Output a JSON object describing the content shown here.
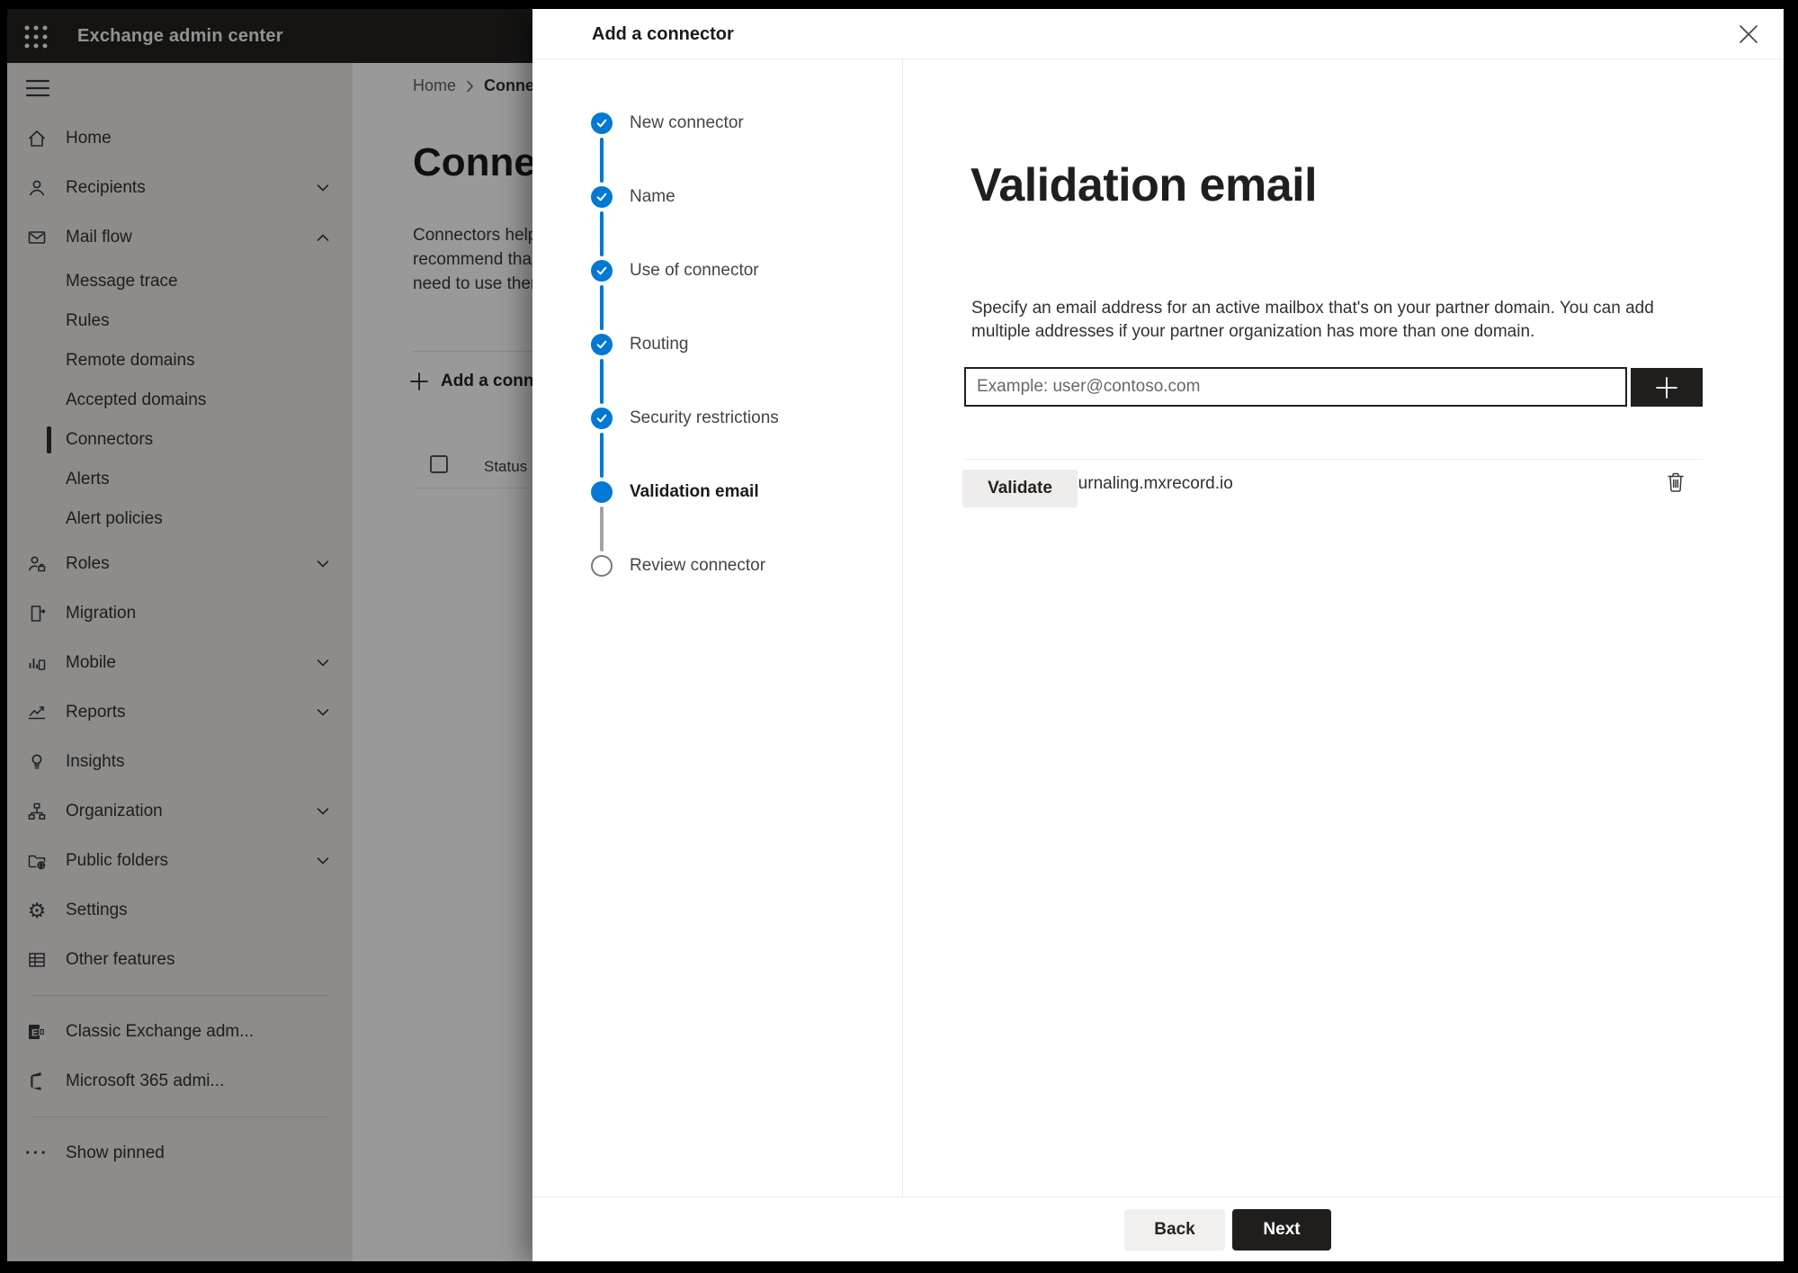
{
  "topbar": {
    "title": "Exchange admin center"
  },
  "sidebar": {
    "items": [
      {
        "label": "Home",
        "icon": "home-icon"
      },
      {
        "label": "Recipients",
        "icon": "person-icon",
        "chevron": "down"
      },
      {
        "label": "Mail flow",
        "icon": "mail-icon",
        "chevron": "up"
      },
      {
        "label": "Message trace",
        "sub": true
      },
      {
        "label": "Rules",
        "sub": true
      },
      {
        "label": "Remote domains",
        "sub": true
      },
      {
        "label": "Accepted domains",
        "sub": true
      },
      {
        "label": "Connectors",
        "sub": true,
        "selected": true
      },
      {
        "label": "Alerts",
        "sub": true
      },
      {
        "label": "Alert policies",
        "sub": true
      },
      {
        "label": "Roles",
        "icon": "roles-icon",
        "chevron": "down"
      },
      {
        "label": "Migration",
        "icon": "migration-icon"
      },
      {
        "label": "Mobile",
        "icon": "mobile-icon",
        "chevron": "down"
      },
      {
        "label": "Reports",
        "icon": "reports-icon",
        "chevron": "down"
      },
      {
        "label": "Insights",
        "icon": "insights-icon"
      },
      {
        "label": "Organization",
        "icon": "organization-icon",
        "chevron": "down"
      },
      {
        "label": "Public folders",
        "icon": "public-folders-icon",
        "chevron": "down"
      },
      {
        "label": "Settings",
        "icon": "settings-icon"
      },
      {
        "label": "Other features",
        "icon": "other-features-icon"
      }
    ],
    "footer_items": [
      {
        "label": "Classic Exchange adm...",
        "icon": "exchange-logo-icon"
      },
      {
        "label": "Microsoft 365 admi...",
        "icon": "microsoft-365-icon"
      }
    ],
    "show_pinned": {
      "label": "Show pinned",
      "icon": "ellipsis-icon"
    }
  },
  "page": {
    "breadcrumb": {
      "home": "Home",
      "current": "Conne"
    },
    "title": "Connec",
    "description_lines": [
      "Connectors help",
      "recommend tha",
      "need to use ther"
    ],
    "add_connector_button": "Add a conn",
    "table": {
      "status_column": "Status"
    }
  },
  "panel": {
    "title": "Add a connector",
    "steps": [
      {
        "label": "New connector",
        "state": "completed"
      },
      {
        "label": "Name",
        "state": "completed"
      },
      {
        "label": "Use of connector",
        "state": "completed"
      },
      {
        "label": "Routing",
        "state": "completed"
      },
      {
        "label": "Security restrictions",
        "state": "completed"
      },
      {
        "label": "Validation email",
        "state": "current"
      },
      {
        "label": "Review connector",
        "state": "upcoming"
      }
    ],
    "content": {
      "heading": "Validation email",
      "description_lines": [
        "Specify an email address for an active mailbox that's on your partner domain. You can add",
        "multiple addresses if your partner organization has more than one domain."
      ],
      "email_input": {
        "value": "",
        "placeholder": "Example: user@contoso.com"
      },
      "addresses": [
        {
          "email": "address@journaling.mxrecord.io"
        }
      ],
      "validate_button": "Validate"
    },
    "footer": {
      "back_button": "Back",
      "next_button": "Next"
    }
  },
  "colors": {
    "accent": "#0078d4",
    "dark_button": "#1f1e1d",
    "overlay": "rgba(0,0,0,0.40)",
    "sidebar_bg": "#eceae8",
    "topbar_bg": "#232221"
  }
}
